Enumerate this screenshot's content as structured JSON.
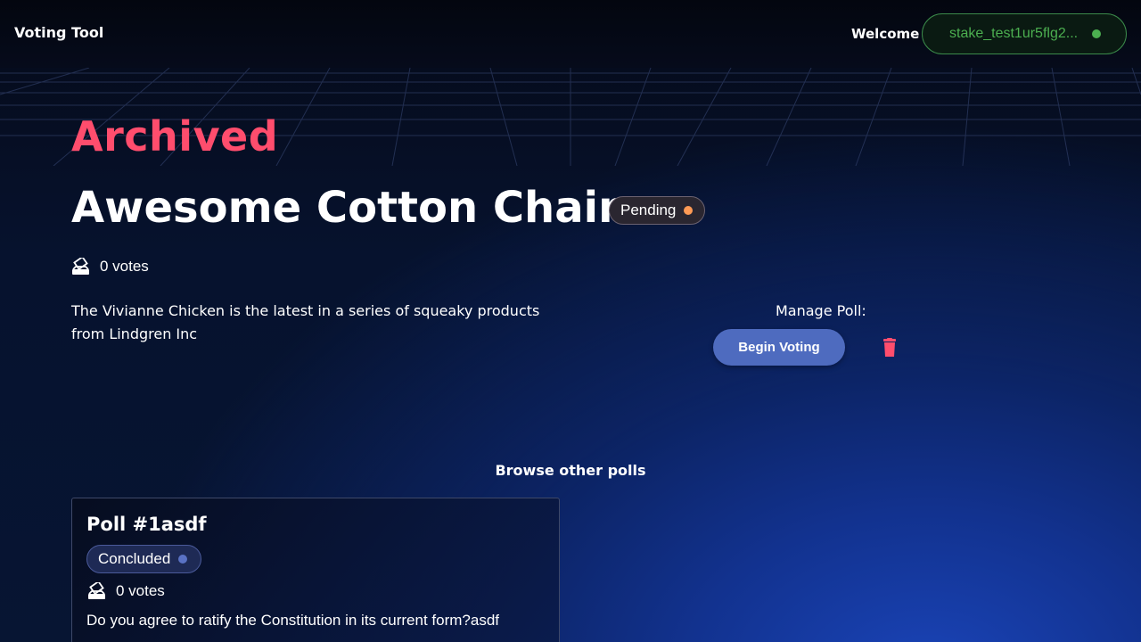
{
  "header": {
    "brand": "Voting Tool",
    "welcome": "Welcome",
    "wallet_address": "stake_test1ur5flg2...",
    "wallet_status_color": "#4caf50"
  },
  "poll": {
    "status_heading": "Archived",
    "title": "Awesome Cotton Chair",
    "badge": "Pending",
    "badge_dot_color": "#ff9a55",
    "votes": "0 votes",
    "description": "The Vivianne Chicken is the latest in a series of squeaky products from Lindgren Inc"
  },
  "manage": {
    "label": "Manage Poll:",
    "begin_button": "Begin Voting",
    "delete_icon": "trash-icon"
  },
  "browse": {
    "heading": "Browse other polls",
    "polls": [
      {
        "title": "Poll #1asdf",
        "badge": "Concluded",
        "votes": "0 votes",
        "description": "Do you agree to ratify the Constitution in its current form?asdf"
      }
    ]
  },
  "colors": {
    "archived": "#ff4d6d",
    "accent_button": "#4e6bbf",
    "trash": "#ff4d6d"
  }
}
